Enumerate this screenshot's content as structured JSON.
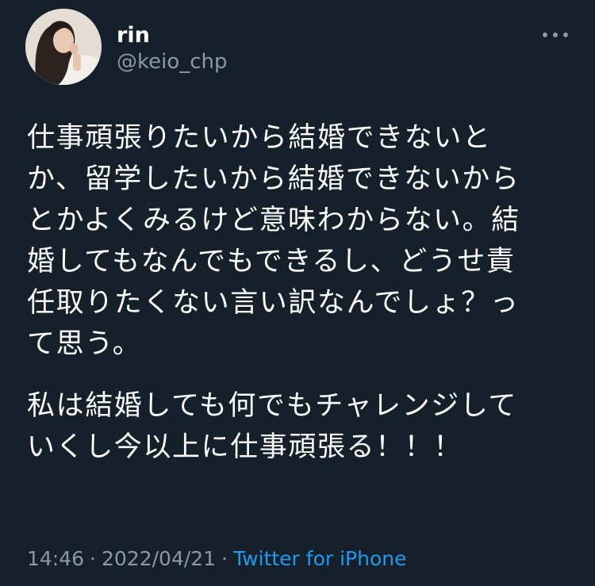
{
  "colors": {
    "background": "#15202b",
    "text_primary": "#ffffff",
    "text_secondary": "#8b98a5",
    "link": "#1d9bf0"
  },
  "author": {
    "display_name": "rin",
    "handle": "@keio_chp",
    "avatar_icon": "profile-photo"
  },
  "actions": {
    "more_icon": "more-horizontal-icon"
  },
  "tweet": {
    "paragraphs": [
      {
        "lines": [
          "仕事頑張りたいから結婚できないと",
          "か、留学したいから結婚できないから",
          "とかよくみるけど意味わからない。結",
          "婚してもなんでもできるし、どうせ責",
          "任取りたくない言い訳なんでしょ？っ",
          "て思う。"
        ]
      },
      {
        "lines": [
          "私は結婚しても何でもチャレンジして",
          "いくし今以上に仕事頑張る！！！"
        ]
      }
    ]
  },
  "meta": {
    "time": "14:46",
    "separator": "·",
    "date": "2022/04/21",
    "source": "Twitter for iPhone"
  }
}
